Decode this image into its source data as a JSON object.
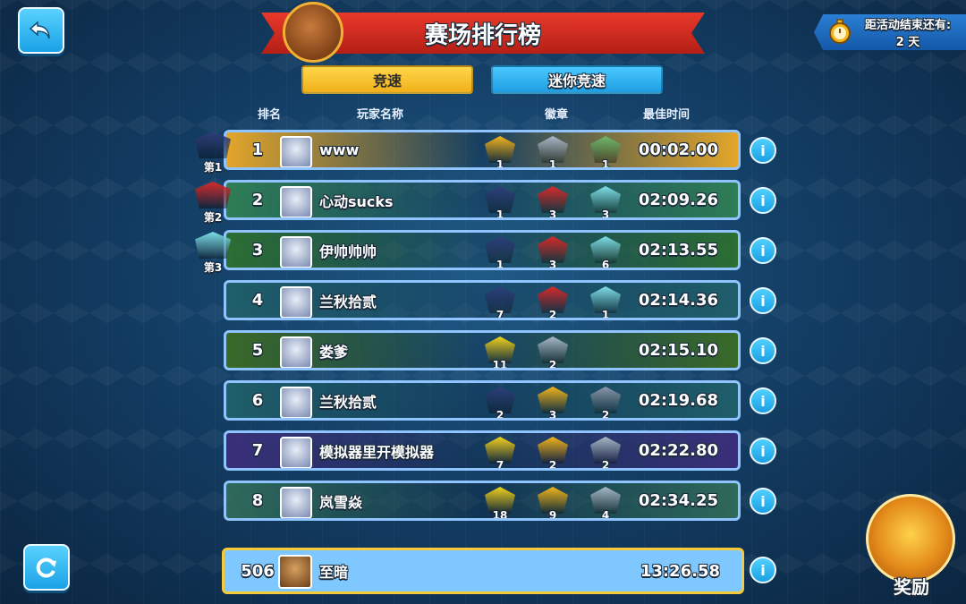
{
  "header": {
    "title": "赛场排行榜"
  },
  "timer": {
    "label": "距活动结束还有:",
    "value": "2 天"
  },
  "tabs": [
    {
      "label": "竞速",
      "active": true
    },
    {
      "label": "迷你竞速",
      "active": false
    }
  ],
  "columns": {
    "rank": "排名",
    "player": "玩家名称",
    "badges": "徽章",
    "best_time": "最佳时间"
  },
  "places": [
    "第1",
    "第2",
    "第3"
  ],
  "rows": [
    {
      "rank": "1",
      "name": "www",
      "badges": [
        {
          "count": "1",
          "color": "#f2b51c"
        },
        {
          "count": "1",
          "color": "#a8b8c8"
        },
        {
          "count": "1",
          "color": "#6fb86a"
        }
      ],
      "time": "00:02.00",
      "bg": "#e3a62b"
    },
    {
      "rank": "2",
      "name": "心动sucks",
      "badges": [
        {
          "count": "1",
          "color": "#2d3f7a"
        },
        {
          "count": "3",
          "color": "#d42a2a"
        },
        {
          "count": "3",
          "color": "#7fe0e8"
        }
      ],
      "time": "02:09.26",
      "bg": "#2f7e56"
    },
    {
      "rank": "3",
      "name": "伊帅帅帅",
      "badges": [
        {
          "count": "1",
          "color": "#2d3f7a"
        },
        {
          "count": "3",
          "color": "#d42a2a"
        },
        {
          "count": "6",
          "color": "#7fe0e8"
        }
      ],
      "time": "02:13.55",
      "bg": "#2c6e33"
    },
    {
      "rank": "4",
      "name": "兰秋拾贰",
      "badges": [
        {
          "count": "7",
          "color": "#2d3f7a"
        },
        {
          "count": "2",
          "color": "#d42a2a"
        },
        {
          "count": "1",
          "color": "#7fe0e8"
        }
      ],
      "time": "02:14.36",
      "bg": "#1f5f6a"
    },
    {
      "rank": "5",
      "name": "娄爹",
      "badges": [
        {
          "count": "11",
          "color": "#f2d21c"
        },
        {
          "count": "2",
          "color": "#a8b8c8"
        }
      ],
      "time": "02:15.10",
      "bg": "#3a6a28"
    },
    {
      "rank": "6",
      "name": "兰秋拾贰",
      "badges": [
        {
          "count": "2",
          "color": "#2d3f7a"
        },
        {
          "count": "3",
          "color": "#f2b51c"
        },
        {
          "count": "2",
          "color": "#8898aa"
        }
      ],
      "time": "02:19.68",
      "bg": "#1f5f6a"
    },
    {
      "rank": "7",
      "name": "模拟器里开模拟器",
      "badges": [
        {
          "count": "7",
          "color": "#f2d21c"
        },
        {
          "count": "2",
          "color": "#f2b51c"
        },
        {
          "count": "2",
          "color": "#a8b8c8"
        }
      ],
      "time": "02:22.80",
      "bg": "#3a2f7a"
    },
    {
      "rank": "8",
      "name": "岚雪焱",
      "badges": [
        {
          "count": "18",
          "color": "#f2d21c"
        },
        {
          "count": "9",
          "color": "#f2b51c"
        },
        {
          "count": "4",
          "color": "#a8b8c8"
        }
      ],
      "time": "02:34.25",
      "bg": "#2f6a5a"
    }
  ],
  "my_row": {
    "rank": "506",
    "name": "至暗",
    "time": "13:26.58"
  },
  "reward": {
    "label": "奖励"
  },
  "info_symbol": "i"
}
